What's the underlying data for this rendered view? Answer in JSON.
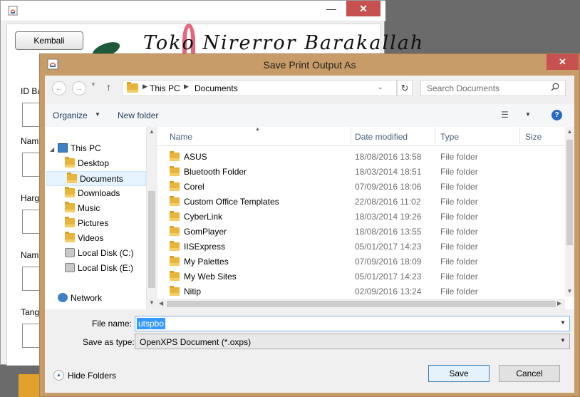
{
  "background_app": {
    "back_button": "Kembali",
    "shop_title": "Toko Nirerror Barakallah",
    "labels": [
      "ID Ba",
      "Nam",
      "Harg",
      "Nam",
      "Tang"
    ],
    "window_controls": {
      "minimize": "—",
      "close": "✕"
    }
  },
  "dialog": {
    "title": "Save Print Output As",
    "close": "✕",
    "address": {
      "segments": [
        "This PC",
        "Documents"
      ]
    },
    "search_placeholder": "Search Documents",
    "toolbar": {
      "organize": "Organize",
      "new_folder": "New folder"
    },
    "nav_tree": [
      {
        "label": "This PC",
        "icon": "pc-icon",
        "level": 0
      },
      {
        "label": "Desktop",
        "icon": "folder-icon",
        "level": 1
      },
      {
        "label": "Documents",
        "icon": "folder-icon",
        "level": 1,
        "selected": true
      },
      {
        "label": "Downloads",
        "icon": "download-folder-icon",
        "level": 1
      },
      {
        "label": "Music",
        "icon": "music-folder-icon",
        "level": 1
      },
      {
        "label": "Pictures",
        "icon": "pictures-folder-icon",
        "level": 1
      },
      {
        "label": "Videos",
        "icon": "videos-folder-icon",
        "level": 1
      },
      {
        "label": "Local Disk (C:)",
        "icon": "disk-icon",
        "level": 1
      },
      {
        "label": "Local Disk (E:)",
        "icon": "disk-icon",
        "level": 1
      },
      {
        "label": "Network",
        "icon": "network-icon",
        "level": 0
      }
    ],
    "columns": {
      "name": "Name",
      "date": "Date modified",
      "type": "Type",
      "size": "Size"
    },
    "files": [
      {
        "name": "ASUS",
        "date": "18/08/2016 13:58",
        "type": "File folder"
      },
      {
        "name": "Bluetooth Folder",
        "date": "18/03/2014 18:51",
        "type": "File folder"
      },
      {
        "name": "Corel",
        "date": "07/09/2016 18:06",
        "type": "File folder"
      },
      {
        "name": "Custom Office Templates",
        "date": "22/08/2016 11:02",
        "type": "File folder"
      },
      {
        "name": "CyberLink",
        "date": "18/03/2014 19:26",
        "type": "File folder"
      },
      {
        "name": "GomPlayer",
        "date": "18/08/2016 13:55",
        "type": "File folder"
      },
      {
        "name": "IISExpress",
        "date": "05/01/2017 14:23",
        "type": "File folder"
      },
      {
        "name": "My Palettes",
        "date": "07/09/2016 18:09",
        "type": "File folder"
      },
      {
        "name": "My Web Sites",
        "date": "05/01/2017 14:23",
        "type": "File folder"
      },
      {
        "name": "Nitip",
        "date": "02/09/2016 13:24",
        "type": "File folder"
      }
    ],
    "file_name_label": "File name:",
    "file_name_value": "utspbo",
    "save_type_label": "Save as type:",
    "save_type_value": "OpenXPS Document (*.oxps)",
    "hide_folders": "Hide Folders",
    "save_button": "Save",
    "cancel_button": "Cancel"
  },
  "colors": {
    "dialog_frame": "#c89c68",
    "close_red": "#c75050",
    "selection_blue": "#3399ff"
  }
}
